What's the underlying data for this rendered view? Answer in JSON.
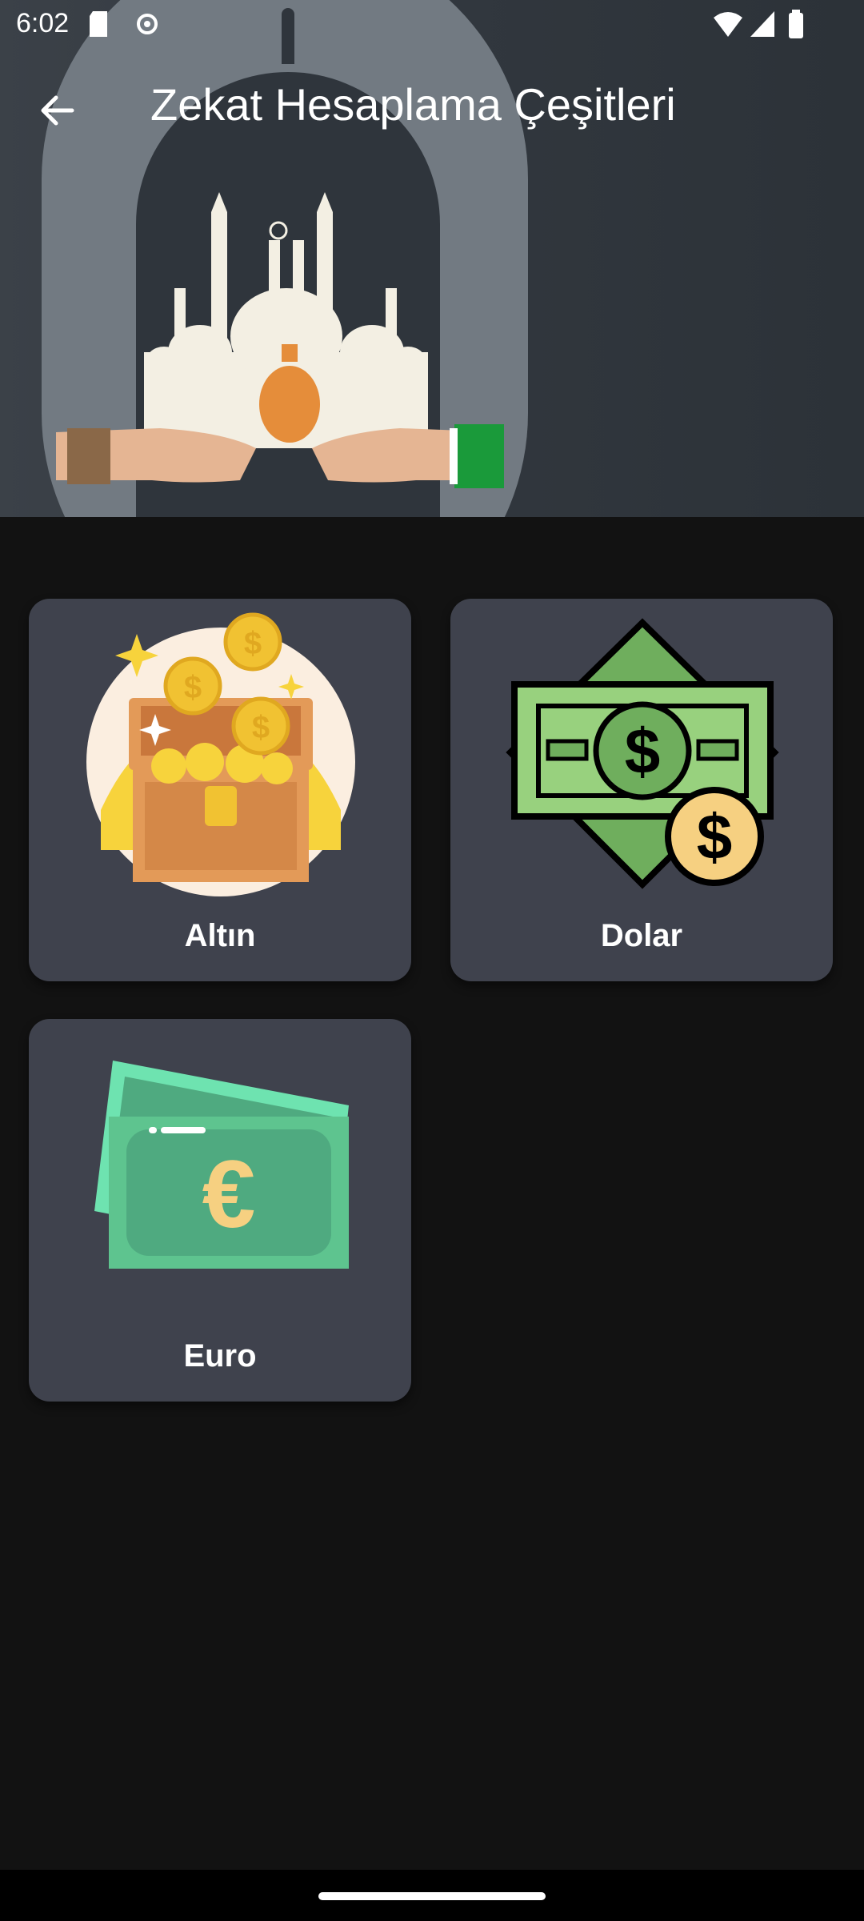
{
  "status_bar": {
    "time": "6:02",
    "icons": [
      "sd-card-icon",
      "settings-icon",
      "wifi-icon",
      "signal-icon",
      "battery-icon"
    ]
  },
  "app_bar": {
    "title": "Zekat Hesaplama Çeşitleri",
    "back_icon": "arrow-left-icon"
  },
  "categories": [
    {
      "label": "Altın",
      "icon": "gold-treasure-chest-icon"
    },
    {
      "label": "Dolar",
      "icon": "dollar-bill-icon"
    },
    {
      "label": "Euro",
      "icon": "euro-banknotes-icon"
    }
  ],
  "colors": {
    "background": "#121212",
    "card": "#3f424d",
    "text": "#ffffff"
  }
}
